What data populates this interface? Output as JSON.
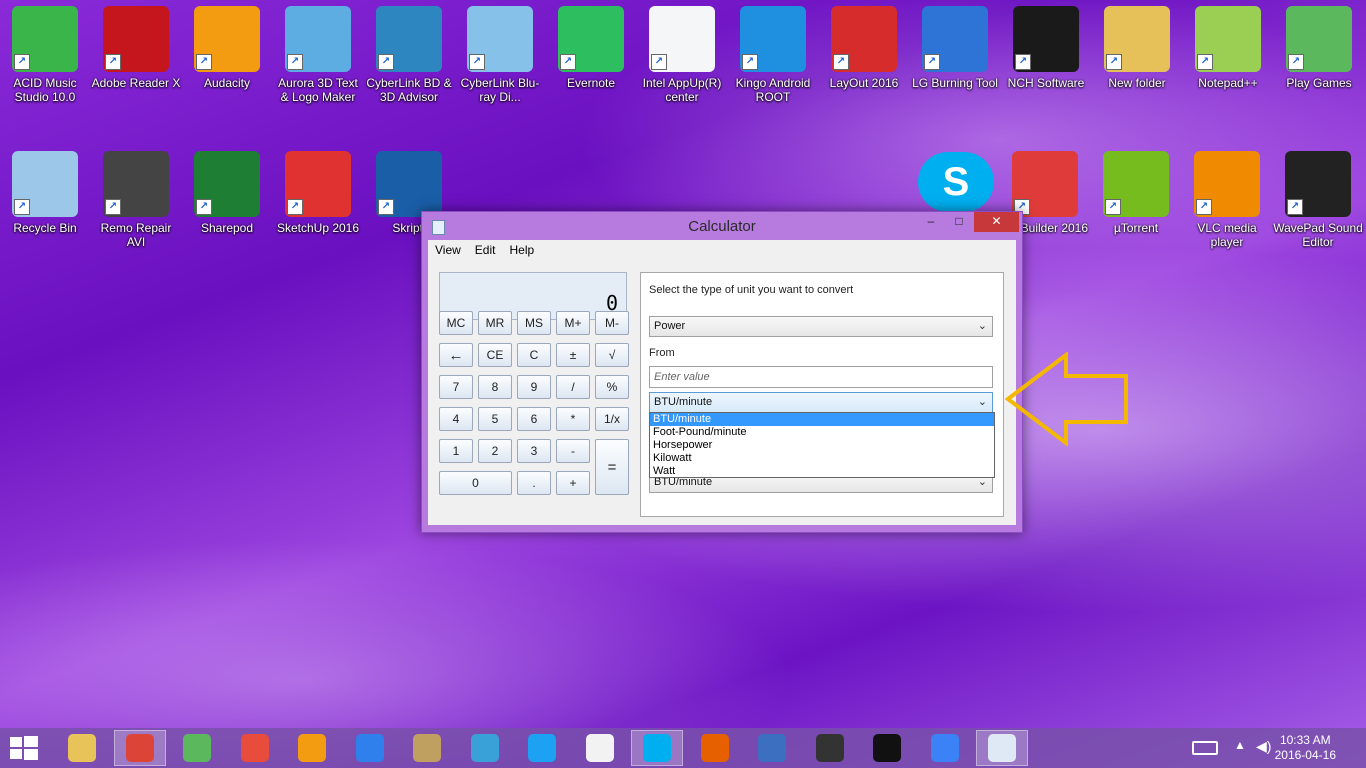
{
  "desktop": {
    "icons_row1": [
      {
        "label": "ACID Music Studio 10.0",
        "icon": "music-note-icon",
        "color": "#39b54a"
      },
      {
        "label": "Adobe Reader X",
        "icon": "adobe-reader-icon",
        "color": "#c4161c"
      },
      {
        "label": "Audacity",
        "icon": "audacity-icon",
        "color": "#f39c12"
      },
      {
        "label": "Aurora 3D Text & Logo Maker",
        "icon": "aurora-3d-icon",
        "color": "#5dade2"
      },
      {
        "label": "CyberLink BD & 3D Advisor",
        "icon": "cyberlink-advisor-icon",
        "color": "#2e86c1"
      },
      {
        "label": "CyberLink Blu-ray Di...",
        "icon": "upload-arrow-icon",
        "color": "#85c1e9"
      },
      {
        "label": "Evernote",
        "icon": "evernote-icon",
        "color": "#2dbe60"
      },
      {
        "label": "Intel AppUp(R) center",
        "icon": "intel-appup-icon",
        "color": "#f4f6f7"
      },
      {
        "label": "Kingo Android ROOT",
        "icon": "kingo-root-icon",
        "color": "#1f8fe0"
      },
      {
        "label": "LayOut 2016",
        "icon": "layout-icon",
        "color": "#d62c2c"
      },
      {
        "label": "LG Burning Tool",
        "icon": "lg-burning-icon",
        "color": "#2d74d6"
      },
      {
        "label": "NCH Software",
        "icon": "nch-icon",
        "color": "#1a1a1a"
      },
      {
        "label": "New folder",
        "icon": "folder-icon",
        "color": "#e6c15a"
      },
      {
        "label": "Notepad++",
        "icon": "notepad-icon",
        "color": "#9bcf53"
      },
      {
        "label": "Play Games",
        "icon": "wildtangent-icon",
        "color": "#5cb85c"
      }
    ],
    "icons_row2": [
      {
        "label": "Recycle Bin",
        "icon": "recycle-bin-icon",
        "color": "#9cc7e8"
      },
      {
        "label": "Remo Repair AVI",
        "icon": "remo-repair-icon",
        "color": "#444444"
      },
      {
        "label": "Sharepod",
        "icon": "sharepod-icon",
        "color": "#1e7e34"
      },
      {
        "label": "SketchUp 2016",
        "icon": "sketchup-icon",
        "color": "#e13232"
      },
      {
        "label": "Skripti",
        "icon": "skripti-icon",
        "color": "#1a5ea8"
      }
    ],
    "icons_row2_right": [
      {
        "label": "yle Builder 2016",
        "icon": "style-builder-icon",
        "color": "#e03b3b"
      },
      {
        "label": "µTorrent",
        "icon": "utorrent-icon",
        "color": "#77bc1f"
      },
      {
        "label": "VLC media player",
        "icon": "vlc-icon",
        "color": "#f08a00"
      },
      {
        "label": "WavePad Sound Editor",
        "icon": "wavepad-icon",
        "color": "#222222"
      }
    ],
    "skype_icon": "skype-icon"
  },
  "calculator": {
    "title": "Calculator",
    "minimize": "–",
    "maximize": "□",
    "close": "✕",
    "menu": [
      "View",
      "Edit",
      "Help"
    ],
    "display_value": "0",
    "memory_buttons": [
      "MC",
      "MR",
      "MS",
      "M+",
      "M-"
    ],
    "row2": [
      "←",
      "CE",
      "C",
      "±",
      "√"
    ],
    "row3": [
      "7",
      "8",
      "9",
      "/",
      "%"
    ],
    "row4": [
      "4",
      "5",
      "6",
      "*",
      "1/x"
    ],
    "row5": [
      "1",
      "2",
      "3",
      "-"
    ],
    "row6": [
      "0",
      ".",
      "+"
    ],
    "equals": "=",
    "converter": {
      "prompt": "Select the type of unit you want to convert",
      "type_selected": "Power",
      "from_label": "From",
      "from_placeholder": "Enter value",
      "from_unit": "BTU/minute",
      "to_unit": "BTU/minute",
      "dropdown_options": [
        "BTU/minute",
        "Foot-Pound/minute",
        "Horsepower",
        "Kilowatt",
        "Watt"
      ],
      "dropdown_selected_index": 0
    }
  },
  "annotation": {
    "arrow_color": "#f5b800"
  },
  "taskbar": {
    "start_icon": "windows-start-icon",
    "apps": [
      {
        "icon": "file-explorer-icon",
        "color": "#e8c35a"
      },
      {
        "icon": "chrome-icon",
        "color": "#db4437",
        "active": true
      },
      {
        "icon": "wildtangent-icon",
        "color": "#5cb85c"
      },
      {
        "icon": "colorful-squares-icon",
        "color": "#e74c3c"
      },
      {
        "icon": "media-player-icon",
        "color": "#f39c12"
      },
      {
        "icon": "malwarebytes-icon",
        "color": "#2f80ed"
      },
      {
        "icon": "museum-icon",
        "color": "#c0a060"
      },
      {
        "icon": "film-strip-icon",
        "color": "#3aa0d8"
      },
      {
        "icon": "bird-app-icon",
        "color": "#1da1f2"
      },
      {
        "icon": "itunes-icon",
        "color": "#f2f2f2"
      },
      {
        "icon": "skype-icon",
        "color": "#00aff0",
        "active": true
      },
      {
        "icon": "firefox-icon",
        "color": "#e66000"
      },
      {
        "icon": "remote-desktop-icon",
        "color": "#3c6fbf"
      },
      {
        "icon": "nch-hat-icon",
        "color": "#333333"
      },
      {
        "icon": "play-circle-icon",
        "color": "#111111"
      },
      {
        "icon": "safari-compass-icon",
        "color": "#3b82f6"
      },
      {
        "icon": "calculator-icon",
        "color": "#dfe9f5",
        "active": true
      }
    ],
    "tray": {
      "keyboard_icon": "keyboard-icon",
      "chevron_icon": "chevron-up-icon",
      "volume_icon": "volume-icon"
    },
    "time": "10:33 AM",
    "date": "2016-04-16"
  }
}
